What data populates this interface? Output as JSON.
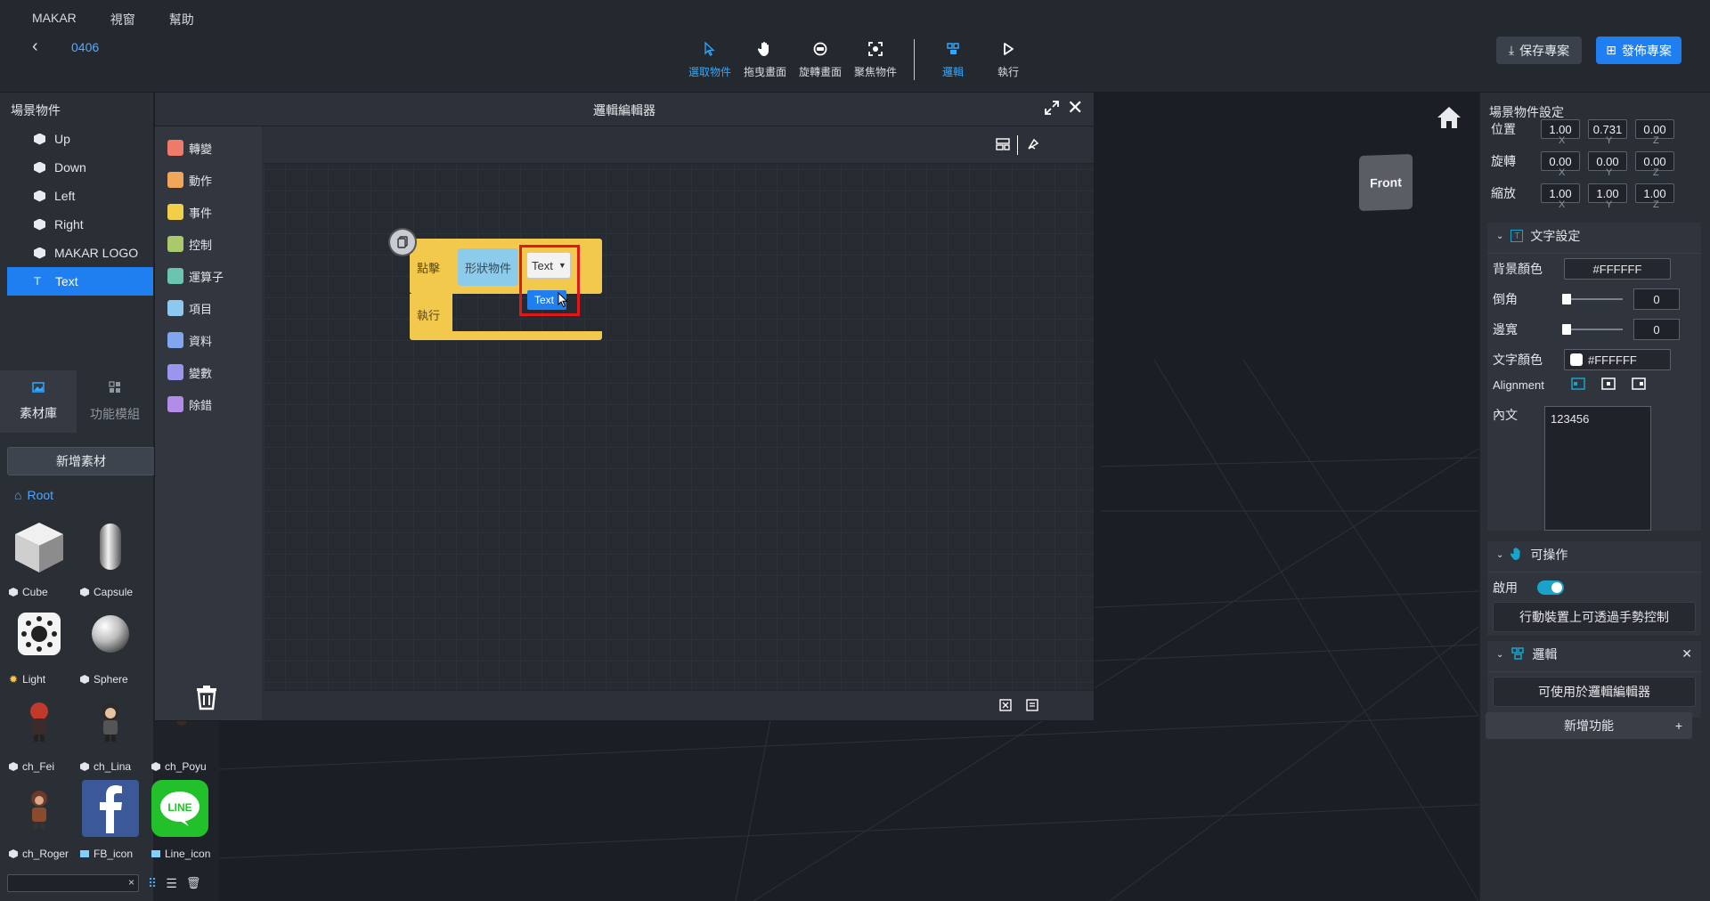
{
  "menu": [
    "MAKAR",
    "視窗",
    "幫助"
  ],
  "project": {
    "name": "0406"
  },
  "toolbar": {
    "tools": [
      {
        "label": "選取物件",
        "icon": "cursor-icon",
        "active": true
      },
      {
        "label": "拖曳畫面",
        "icon": "hand-icon",
        "active": false
      },
      {
        "label": "旋轉畫面",
        "icon": "rotate-icon",
        "active": false
      },
      {
        "label": "聚焦物件",
        "icon": "focus-icon",
        "active": false
      },
      {
        "label": "邏輯",
        "icon": "logic-icon",
        "active": true
      },
      {
        "label": "執行",
        "icon": "play-icon",
        "active": false
      }
    ],
    "save_label": "保存專案",
    "publish_label": "發佈專案"
  },
  "scene": {
    "title": "場景物件",
    "items": [
      {
        "label": "Up",
        "icon": "cube-icon",
        "selected": false
      },
      {
        "label": "Down",
        "icon": "cube-icon",
        "selected": false
      },
      {
        "label": "Left",
        "icon": "cube-icon",
        "selected": false
      },
      {
        "label": "Right",
        "icon": "cube-icon",
        "selected": false
      },
      {
        "label": "MAKAR LOGO",
        "icon": "cube-icon",
        "selected": false
      },
      {
        "label": "Text",
        "icon": "text-icon",
        "selected": true
      }
    ]
  },
  "library": {
    "tabs": [
      {
        "label": "素材庫",
        "active": true
      },
      {
        "label": "功能模組",
        "active": false
      }
    ],
    "add_label": "新增素材",
    "root_label": "Root",
    "assets": [
      {
        "label": "Cube"
      },
      {
        "label": "Capsule"
      },
      {
        "label": "Light"
      },
      {
        "label": "Sphere"
      },
      {
        "label": "ch_Fei"
      },
      {
        "label": "ch_Lina"
      },
      {
        "label": "ch_Poyu"
      },
      {
        "label": "ch_Roger"
      },
      {
        "label": "FB_icon"
      },
      {
        "label": "Line_icon"
      }
    ],
    "search_clear": "×"
  },
  "viewport": {
    "gizmo_label": "Front"
  },
  "logic_editor": {
    "title": "邏輯編輯器",
    "categories": [
      {
        "label": "轉變",
        "color": "#f07a6a"
      },
      {
        "label": "動作",
        "color": "#f2a65a"
      },
      {
        "label": "事件",
        "color": "#f2cf4a"
      },
      {
        "label": "控制",
        "color": "#a9c96a"
      },
      {
        "label": "運算子",
        "color": "#6cc4b0"
      },
      {
        "label": "項目",
        "color": "#8cc8f0"
      },
      {
        "label": "資料",
        "color": "#7fa6ef"
      },
      {
        "label": "變數",
        "color": "#9a95ef"
      },
      {
        "label": "除錯",
        "color": "#b28ce8"
      }
    ],
    "block": {
      "event_label": "點擊",
      "shape_label": "形狀物件",
      "dropdown_value": "Text",
      "dropdown_option": "Text",
      "do_label": "執行"
    }
  },
  "properties": {
    "title": "場景物件設定",
    "transform": [
      {
        "label": "位置",
        "values": [
          "1.00",
          "0.731",
          "0.00"
        ]
      },
      {
        "label": "旋轉",
        "values": [
          "0.00",
          "0.00",
          "0.00"
        ]
      },
      {
        "label": "縮放",
        "values": [
          "1.00",
          "1.00",
          "1.00"
        ]
      }
    ],
    "axes": [
      "X",
      "Y",
      "Z"
    ],
    "text_settings": {
      "title": "文字設定",
      "bg_color_label": "背景顏色",
      "bg_color": "#FFFFFF",
      "corner_label": "倒角",
      "corner_value": "0",
      "border_label": "邊寬",
      "border_value": "0",
      "text_color_label": "文字顏色",
      "text_color": "#FFFFFF",
      "alignment_label": "Alignment",
      "content_label": "內文",
      "content": "123456"
    },
    "interactable": {
      "title": "可操作",
      "enable_label": "啟用",
      "enabled": true,
      "gesture_button": "行動裝置上可透過手勢控制"
    },
    "logic": {
      "title": "邏輯",
      "button": "可使用於邏輯編輯器"
    },
    "add_feature": "新增功能"
  }
}
